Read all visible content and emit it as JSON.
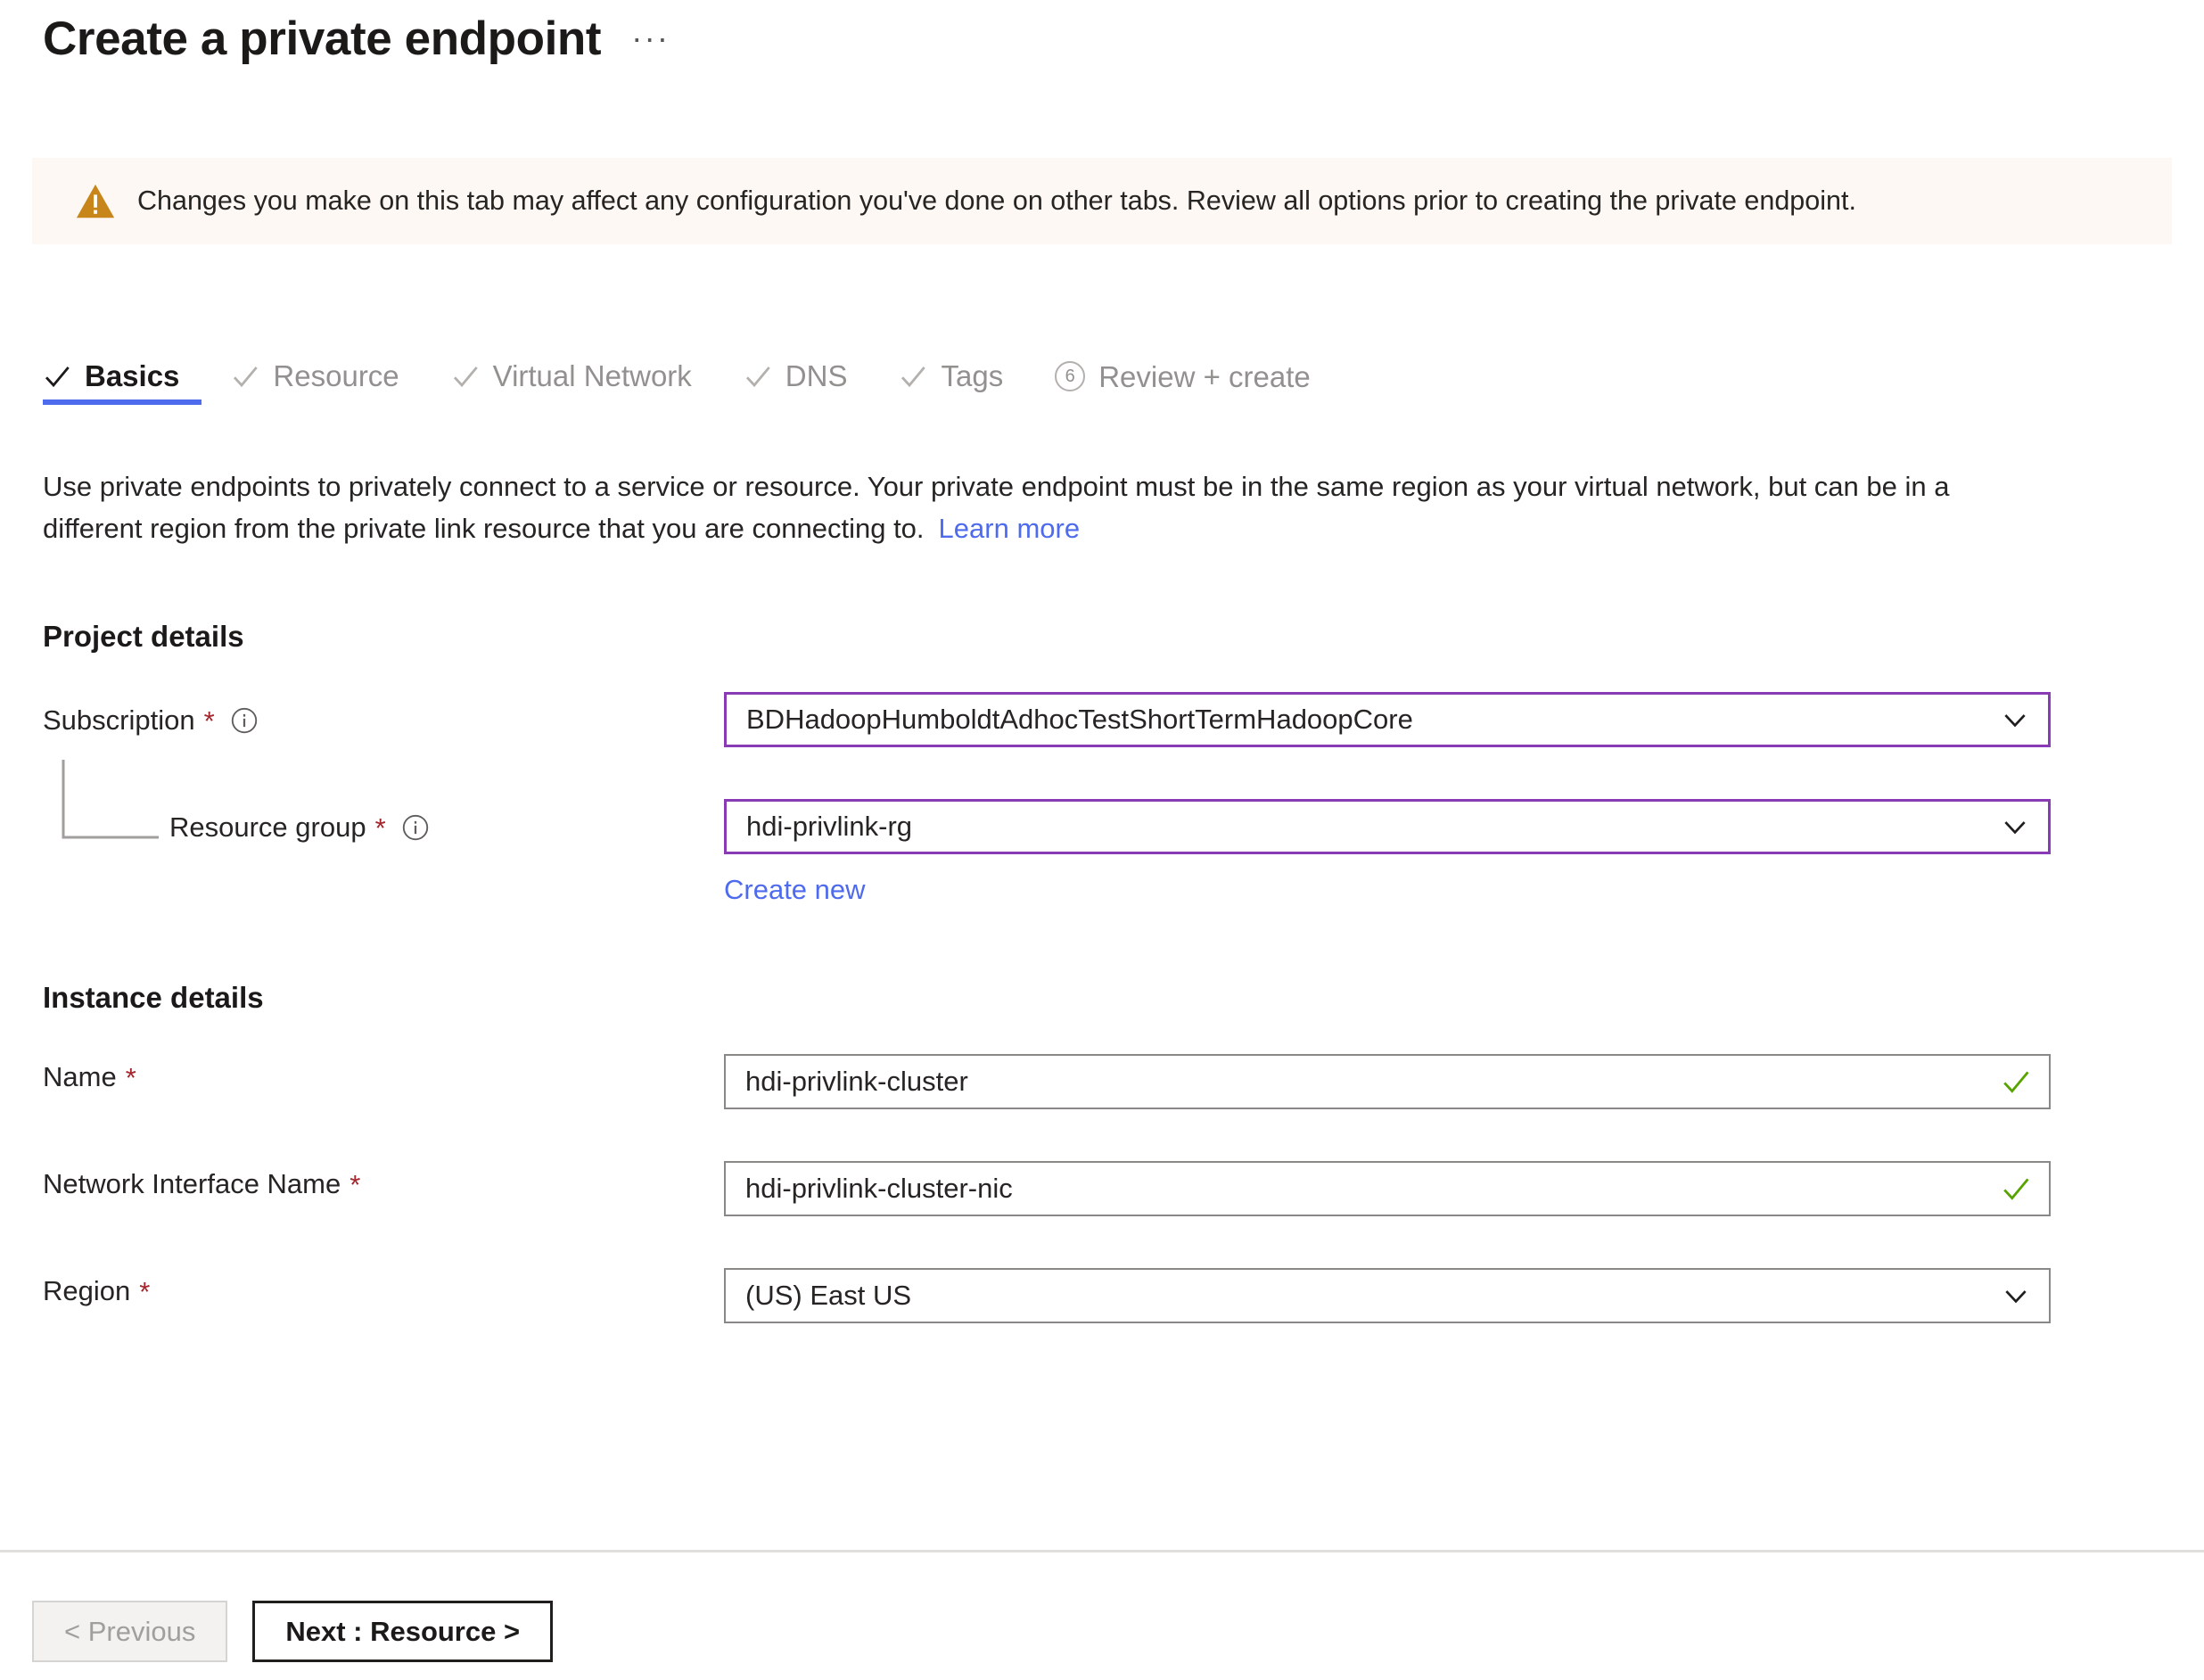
{
  "header": {
    "title": "Create a private endpoint",
    "more_label": "···"
  },
  "banner": {
    "icon": "warning-triangle-icon",
    "text": "Changes you make on this tab may affect any configuration you've done on other tabs. Review all options prior to creating the private endpoint.",
    "background": "#fdf8f3",
    "icon_color": "#c8861a"
  },
  "tabs": [
    {
      "label": "Basics",
      "state": "active",
      "marker": "check"
    },
    {
      "label": "Resource",
      "state": "complete",
      "marker": "check"
    },
    {
      "label": "Virtual Network",
      "state": "complete",
      "marker": "check"
    },
    {
      "label": "DNS",
      "state": "complete",
      "marker": "check"
    },
    {
      "label": "Tags",
      "state": "complete",
      "marker": "check"
    },
    {
      "label": "Review + create",
      "state": "pending",
      "marker": "number",
      "number": "6"
    }
  ],
  "description": {
    "line1": "Use private endpoints to privately connect to a service or resource. Your private endpoint must be in the same region as your",
    "line2": "virtual network, but can be in a different region from the private link resource that you are connecting to.",
    "learn_more": "Learn more"
  },
  "sections": {
    "project_details": "Project details",
    "instance_details": "Instance details"
  },
  "fields": {
    "subscription": {
      "label": "Subscription",
      "required": "*",
      "value": "BDHadoopHumboldtAdhocTestShortTermHadoopCore",
      "control": "dropdown",
      "border": "#893ab5"
    },
    "resource_group": {
      "label": "Resource group",
      "required": "*",
      "value": "hdi-privlink-rg",
      "control": "dropdown",
      "border": "#893ab5",
      "create_new": "Create new"
    },
    "name": {
      "label": "Name",
      "required": "*",
      "value": "hdi-privlink-cluster",
      "control": "textbox",
      "validation": "valid"
    },
    "network_interface_name": {
      "label": "Network Interface Name",
      "required": "*",
      "value": "hdi-privlink-cluster-nic",
      "control": "textbox",
      "validation": "valid"
    },
    "region": {
      "label": "Region",
      "required": "*",
      "value": "(US) East US",
      "control": "dropdown"
    }
  },
  "footer": {
    "previous": "< Previous",
    "next": "Next : Resource >"
  },
  "colors": {
    "accent": "#4f6bed",
    "link": "#4f6bed",
    "required": "#a4262c",
    "valid": "#57a300",
    "focus_border": "#893ab5"
  }
}
